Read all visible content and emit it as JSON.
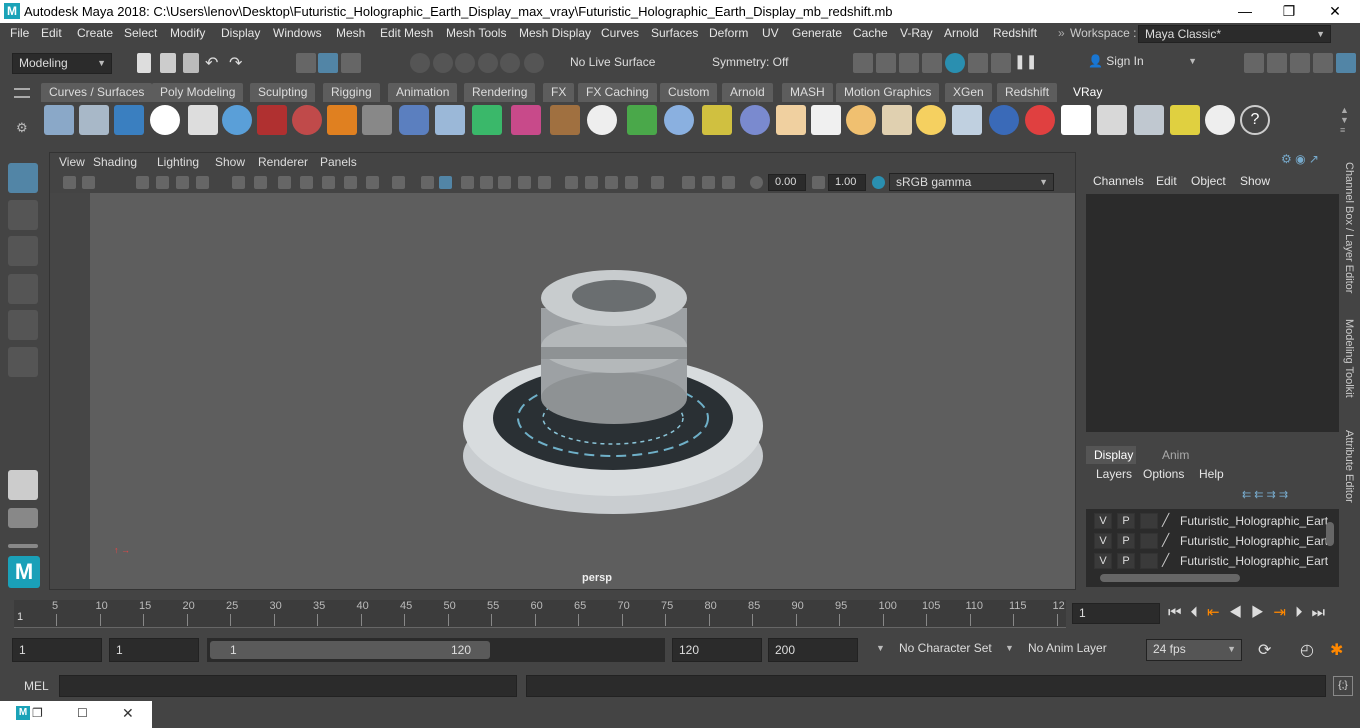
{
  "window": {
    "title": "Autodesk Maya 2018: C:\\Users\\lenov\\Desktop\\Futuristic_Holographic_Earth_Display_max_vray\\Futuristic_Holographic_Earth_Display_mb_redshift.mb",
    "app_icon": "M",
    "minimize": "—",
    "maximize": "❐",
    "close": "✕"
  },
  "menus": [
    "File",
    "Edit",
    "Create",
    "Select",
    "Modify",
    "Display",
    "Windows",
    "Mesh",
    "Edit Mesh",
    "Mesh Tools",
    "Mesh Display",
    "Curves",
    "Surfaces",
    "Deform",
    "UV",
    "Generate",
    "Cache",
    "V-Ray",
    "Arnold",
    "Redshift"
  ],
  "workspace": {
    "label": "Workspace :",
    "value": "Maya Classic*"
  },
  "toolbar": {
    "mode": "Modeling",
    "live_surface": "No Live Surface",
    "symmetry": "Symmetry: Off",
    "sign_in": "Sign In"
  },
  "shelf_tabs": [
    "Curves / Surfaces",
    "Poly Modeling",
    "Sculpting",
    "Rigging",
    "Animation",
    "Rendering",
    "FX",
    "FX Caching",
    "Custom",
    "Arnold",
    "MASH",
    "Motion Graphics",
    "XGen",
    "Redshift",
    "VRay"
  ],
  "active_shelf_tab": "VRay",
  "viewport": {
    "menus": [
      "View",
      "Shading",
      "Lighting",
      "Show",
      "Renderer",
      "Panels"
    ],
    "exposure": "0.00",
    "gamma": "1.00",
    "color_space": "sRGB gamma",
    "camera_label": "persp"
  },
  "channel_box": {
    "menus": [
      "Channels",
      "Edit",
      "Object",
      "Show"
    ]
  },
  "side_tabs": [
    "Channel Box / Layer Editor",
    "Modeling Toolkit",
    "Attribute Editor"
  ],
  "layer_editor": {
    "tabs": [
      "Display",
      "Anim"
    ],
    "menus": [
      "Layers",
      "Options",
      "Help"
    ],
    "layers": [
      {
        "v": "V",
        "p": "P",
        "name": "Futuristic_Holographic_Eart"
      },
      {
        "v": "V",
        "p": "P",
        "name": "Futuristic_Holographic_Eart"
      },
      {
        "v": "V",
        "p": "P",
        "name": "Futuristic_Holographic_Eart"
      }
    ]
  },
  "timeline": {
    "ticks": [
      "5",
      "10",
      "15",
      "20",
      "25",
      "30",
      "35",
      "40",
      "45",
      "50",
      "55",
      "60",
      "65",
      "70",
      "75",
      "80",
      "85",
      "90",
      "95",
      "100",
      "105",
      "110",
      "115",
      "12"
    ],
    "start_marker": "1",
    "current_frame": "1"
  },
  "range": {
    "start": "1",
    "playback_start": "1",
    "slider_start": "1",
    "slider_end": "120",
    "playback_end": "120",
    "end": "200",
    "character_set": "No Character Set",
    "anim_layer": "No Anim Layer",
    "fps": "24 fps"
  },
  "command_line": {
    "label": "MEL"
  }
}
